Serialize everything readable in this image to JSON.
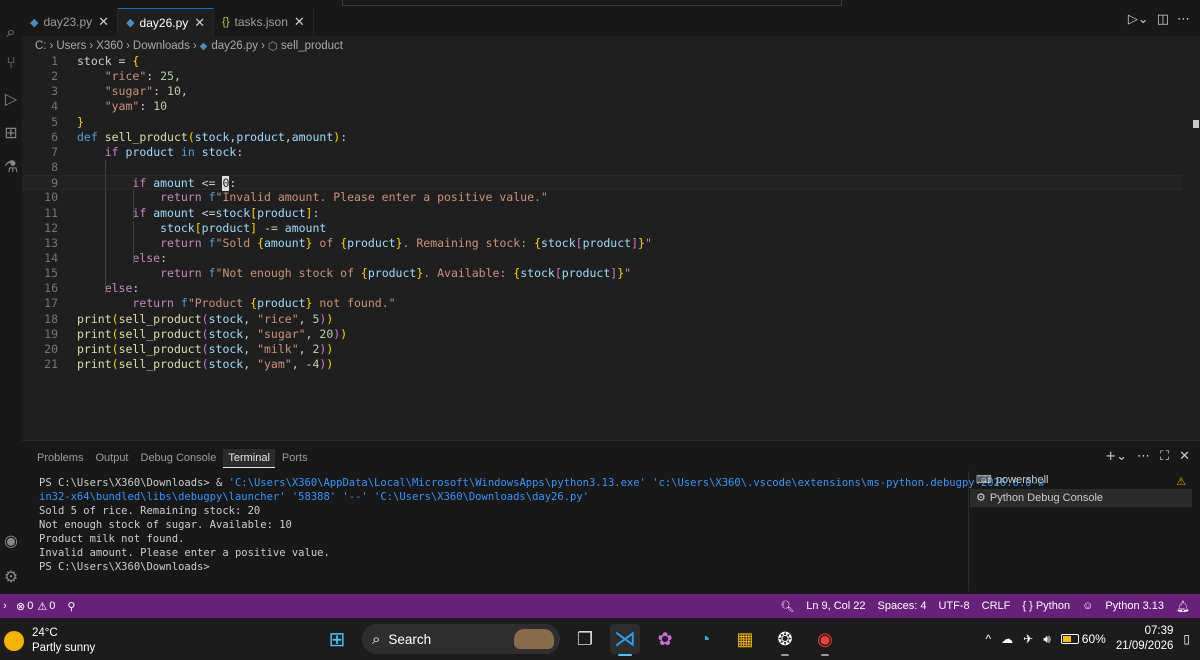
{
  "tabs": [
    {
      "label": "day23.py",
      "type": "py",
      "close": "✕"
    },
    {
      "label": "day26.py",
      "type": "py",
      "close": "✕"
    },
    {
      "label": "tasks.json",
      "type": "json",
      "close": "✕"
    }
  ],
  "active_tab": 1,
  "breadcrumb": {
    "drive": "C:",
    "folder1": "Users",
    "folder2": "X360",
    "folder3": "Downloads",
    "file": "day26.py",
    "symbol": "sell_product"
  },
  "editor": {
    "current_line": 9,
    "lines": [
      {
        "n": "1",
        "html": "stock = <span class=\"t-br1\">{</span>"
      },
      {
        "n": "2",
        "html": "    <span class=\"t-str\">\"rice\"</span>: <span class=\"t-num\">25</span>,"
      },
      {
        "n": "3",
        "html": "    <span class=\"t-str\">\"sugar\"</span>: <span class=\"t-num\">10</span>,"
      },
      {
        "n": "4",
        "html": "    <span class=\"t-str\">\"yam\"</span>: <span class=\"t-num\">10</span>"
      },
      {
        "n": "5",
        "html": "<span class=\"t-br1\">}</span>"
      },
      {
        "n": "6",
        "html": "<span class=\"t-def\">def</span> <span class=\"t-fn\">sell_product</span><span class=\"t-br1\">(</span><span class=\"t-var\">stock</span>,<span class=\"t-var\">product</span>,<span class=\"t-var\">amount</span><span class=\"t-br1\">)</span>:"
      },
      {
        "n": "7",
        "html": "    <span class=\"t-key\">if</span> <span class=\"t-var\">product</span> <span class=\"t-def\">in</span> <span class=\"t-var\">stock</span>:"
      },
      {
        "n": "8",
        "html": ""
      },
      {
        "n": "9",
        "html": "        <span class=\"t-key\">if</span> <span class=\"t-var\">amount</span> &lt;= <span class=\"cursor\">0</span>:"
      },
      {
        "n": "10",
        "html": "            <span class=\"t-key\">return</span> <span class=\"t-def\">f</span><span class=\"t-str\">\"Invalid amount. Please enter a positive value.\"</span>"
      },
      {
        "n": "11",
        "html": "        <span class=\"t-key\">if</span> <span class=\"t-var\">amount</span> &lt;=<span class=\"t-var\">stock</span><span class=\"t-br1\">[</span><span class=\"t-var\">product</span><span class=\"t-br1\">]</span>:"
      },
      {
        "n": "12",
        "html": "            <span class=\"t-var\">stock</span><span class=\"t-br1\">[</span><span class=\"t-var\">product</span><span class=\"t-br1\">]</span> -= <span class=\"t-var\">amount</span>"
      },
      {
        "n": "13",
        "html": "            <span class=\"t-key\">return</span> <span class=\"t-def\">f</span><span class=\"t-str\">\"Sold </span><span class=\"t-br1\">{</span><span class=\"t-var\">amount</span><span class=\"t-br1\">}</span><span class=\"t-str\"> of </span><span class=\"t-br1\">{</span><span class=\"t-var\">product</span><span class=\"t-br1\">}</span><span class=\"t-str\">. Remaining stock: </span><span class=\"t-br1\">{</span><span class=\"t-var\">stock</span><span class=\"t-br2\">[</span><span class=\"t-var\">product</span><span class=\"t-br2\">]</span><span class=\"t-br1\">}</span><span class=\"t-str\">\"</span>"
      },
      {
        "n": "14",
        "html": "        <span class=\"t-key\">else</span>:"
      },
      {
        "n": "15",
        "html": "            <span class=\"t-key\">return</span> <span class=\"t-def\">f</span><span class=\"t-str\">\"Not enough stock of </span><span class=\"t-br1\">{</span><span class=\"t-var\">product</span><span class=\"t-br1\">}</span><span class=\"t-str\">. Available: </span><span class=\"t-br1\">{</span><span class=\"t-var\">stock</span><span class=\"t-br2\">[</span><span class=\"t-var\">product</span><span class=\"t-br2\">]</span><span class=\"t-br1\">}</span><span class=\"t-str\">\"</span>"
      },
      {
        "n": "16",
        "html": "    <span class=\"t-key\">else</span>:"
      },
      {
        "n": "17",
        "html": "        <span class=\"t-key\">return</span> <span class=\"t-def\">f</span><span class=\"t-str\">\"Product </span><span class=\"t-br1\">{</span><span class=\"t-var\">product</span><span class=\"t-br1\">}</span><span class=\"t-str\"> not found.\"</span>"
      },
      {
        "n": "18",
        "html": "<span class=\"t-fn\">print</span><span class=\"t-br1\">(</span><span class=\"t-fn\">sell_product</span><span class=\"t-br2\">(</span><span class=\"t-var\">stock</span>, <span class=\"t-str\">\"rice\"</span>, <span class=\"t-num\">5</span><span class=\"t-br2\">)</span><span class=\"t-br1\">)</span>"
      },
      {
        "n": "19",
        "html": "<span class=\"t-fn\">print</span><span class=\"t-br1\">(</span><span class=\"t-fn\">sell_product</span><span class=\"t-br2\">(</span><span class=\"t-var\">stock</span>, <span class=\"t-str\">\"sugar\"</span>, <span class=\"t-num\">20</span><span class=\"t-br2\">)</span><span class=\"t-br1\">)</span>"
      },
      {
        "n": "20",
        "html": "<span class=\"t-fn\">print</span><span class=\"t-br1\">(</span><span class=\"t-fn\">sell_product</span><span class=\"t-br2\">(</span><span class=\"t-var\">stock</span>, <span class=\"t-str\">\"milk\"</span>, <span class=\"t-num\">2</span><span class=\"t-br2\">)</span><span class=\"t-br1\">)</span>"
      },
      {
        "n": "21",
        "html": "<span class=\"t-fn\">print</span><span class=\"t-br1\">(</span><span class=\"t-fn\">sell_product</span><span class=\"t-br2\">(</span><span class=\"t-var\">stock</span>, <span class=\"t-str\">\"yam\"</span>, -<span class=\"t-num\">4</span><span class=\"t-br2\">)</span><span class=\"t-br1\">)</span>"
      }
    ]
  },
  "panel": {
    "tabs": [
      "Problems",
      "Output",
      "Debug Console",
      "Terminal",
      "Ports"
    ],
    "active_tab": 3,
    "terminal": {
      "cmd_prompt": "PS C:\\Users\\X360\\Downloads> & ",
      "cmd_path1": "'C:\\Users\\X360\\AppData\\Local\\Microsoft\\WindowsApps\\python3.13.exe' 'c:\\Users\\X360\\.vscode\\extensions\\ms-python.debugpy-2026.6.0-w",
      "cmd_path2": "in32-x64\\bundled\\libs\\debugpy\\launcher' '58388' '--' 'C:\\Users\\X360\\Downloads\\day26.py'",
      "out1": "Sold 5 of rice. Remaining stock: 20",
      "out2": "Not enough stock of sugar. Available: 10",
      "out3": "Product milk not found.",
      "out4": "Invalid amount. Please enter a positive value.",
      "prompt_end": "PS C:\\Users\\X360\\Downloads>"
    },
    "terminal_list": [
      {
        "label": "powershell",
        "icon": "terminal-icon"
      },
      {
        "label": "Python Debug Console",
        "icon": "debug-icon"
      }
    ]
  },
  "status_bar": {
    "errors": "0",
    "warnings": "0",
    "position": "Ln 9, Col 22",
    "spaces": "Spaces: 4",
    "encoding": "UTF-8",
    "eol": "CRLF",
    "language": "Python",
    "interpreter": "Python 3.13",
    "background_color": "#68217a"
  },
  "taskbar": {
    "temperature": "24°C",
    "weather": "Partly sunny",
    "search": "Search",
    "battery": "60%",
    "battery_level": 0.6,
    "time": "07:39",
    "date": "21/09/2026"
  },
  "colors": {
    "accent": "#0078d4",
    "editor_bg": "#1f1f1f",
    "keyword": "#c586c0",
    "string": "#ce9178"
  }
}
